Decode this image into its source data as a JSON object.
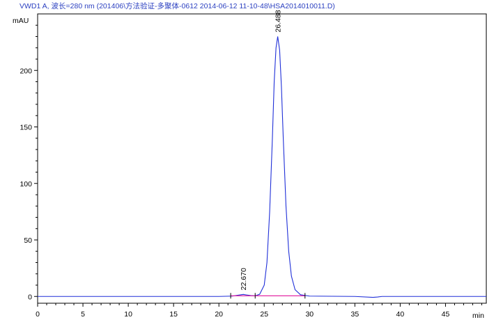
{
  "title": "VWD1 A, 波长=280 nm (201406\\方法验证-多聚体-0612 2014-06-12 11-10-48\\HSA2014010011.D)",
  "chart_data": {
    "type": "line",
    "title": "VWD1 A, 波长=280 nm (201406\\方法验证-多聚体-0612 2014-06-12 11-10-48\\HSA2014010011.D)",
    "xlabel": "min",
    "ylabel": "mAU",
    "xlim": [
      0,
      49.5
    ],
    "ylim": [
      -6,
      250
    ],
    "x_ticks": [
      0,
      5,
      10,
      15,
      20,
      25,
      30,
      35,
      40,
      45
    ],
    "x_tick_labels": [
      "0",
      "5",
      "10",
      "15",
      "20",
      "25",
      "30",
      "35",
      "40",
      "45"
    ],
    "y_ticks": [
      0,
      50,
      100,
      150,
      200
    ],
    "y_tick_labels": [
      "0",
      "50",
      "100",
      "150",
      "200"
    ],
    "grid": false,
    "series": [
      {
        "color": "#1f2fd8",
        "x": [
          0,
          5,
          10,
          15,
          20,
          21.5,
          22.0,
          22.5,
          22.7,
          23.0,
          23.5,
          24.0,
          24.5,
          25.0,
          25.3,
          25.6,
          25.9,
          26.1,
          26.3,
          26.488,
          26.7,
          26.9,
          27.1,
          27.4,
          27.7,
          28.0,
          28.4,
          29.0,
          30,
          35,
          37.0,
          37.5,
          38.0,
          40,
          45,
          49.5
        ],
        "y": [
          0,
          0,
          0,
          0,
          0,
          0.3,
          1.0,
          1.6,
          1.8,
          1.4,
          0.8,
          0.5,
          2,
          10,
          30,
          75,
          140,
          190,
          220,
          230,
          218,
          185,
          140,
          80,
          40,
          18,
          6,
          1.5,
          0.3,
          0,
          -0.8,
          -0.5,
          0,
          0,
          0,
          0
        ]
      },
      {
        "color": "#e0109a",
        "x": [
          21.3,
          24.0,
          24.0,
          29.5
        ],
        "y": [
          0.6,
          0.6,
          0.6,
          0.6
        ]
      }
    ],
    "annotations": [
      {
        "text": "22.670",
        "x": 22.67,
        "y": 1.8
      },
      {
        "text": "26.488",
        "x": 26.488,
        "y": 230
      }
    ]
  }
}
